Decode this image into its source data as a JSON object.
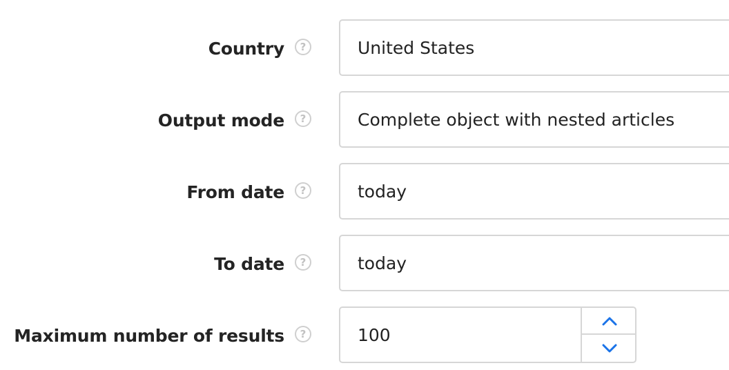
{
  "form": {
    "rows": [
      {
        "label": "Country",
        "value": "United States"
      },
      {
        "label": "Output mode",
        "value": "Complete object with nested articles"
      },
      {
        "label": "From date",
        "value": "today"
      },
      {
        "label": "To date",
        "value": "today"
      },
      {
        "label": "Maximum number of results",
        "value": "100"
      }
    ],
    "help_glyph": "?"
  },
  "icons": {
    "help": "question-circle-icon",
    "increment": "chevron-up-icon",
    "decrement": "chevron-down-icon"
  },
  "colors": {
    "label_text": "#242424",
    "field_border": "#d6d6d6",
    "help_icon": "#cfcfcf",
    "stepper_accent": "#1a73e8"
  }
}
